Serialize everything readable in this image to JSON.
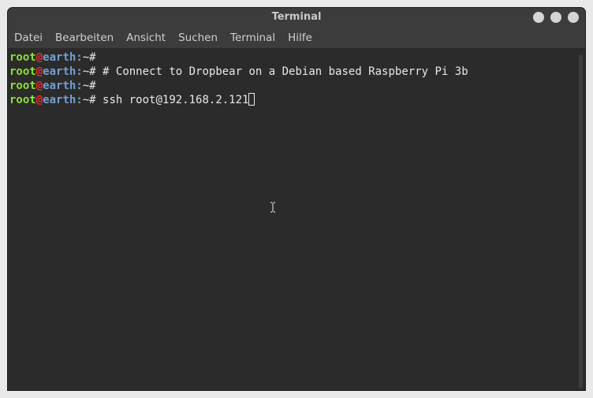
{
  "window": {
    "title": "Terminal"
  },
  "menu": {
    "items": [
      "Datei",
      "Bearbeiten",
      "Ansicht",
      "Suchen",
      "Terminal",
      "Hilfe"
    ]
  },
  "terminal": {
    "lines": [
      {
        "user": "root",
        "at": "@",
        "host": "earth",
        "sep": ":",
        "cwd": "~#",
        "cmd": ""
      },
      {
        "user": "root",
        "at": "@",
        "host": "earth",
        "sep": ":",
        "cwd": "~#",
        "cmd": " # Connect to Dropbear on a Debian based Raspberry Pi 3b"
      },
      {
        "user": "root",
        "at": "@",
        "host": "earth",
        "sep": ":",
        "cwd": "~#",
        "cmd": ""
      },
      {
        "user": "root",
        "at": "@",
        "host": "earth",
        "sep": ":",
        "cwd": "~#",
        "cmd": " ssh root@192.168.2.121"
      }
    ]
  },
  "colors": {
    "user": "#8ae234",
    "at": "#ef2929",
    "host": "#729fcf",
    "background": "#2b2b2b",
    "titlebar": "#3c3c3c"
  },
  "icons": {
    "cursor": "block-cursor-icon",
    "mouse": "i-beam-cursor-icon"
  }
}
